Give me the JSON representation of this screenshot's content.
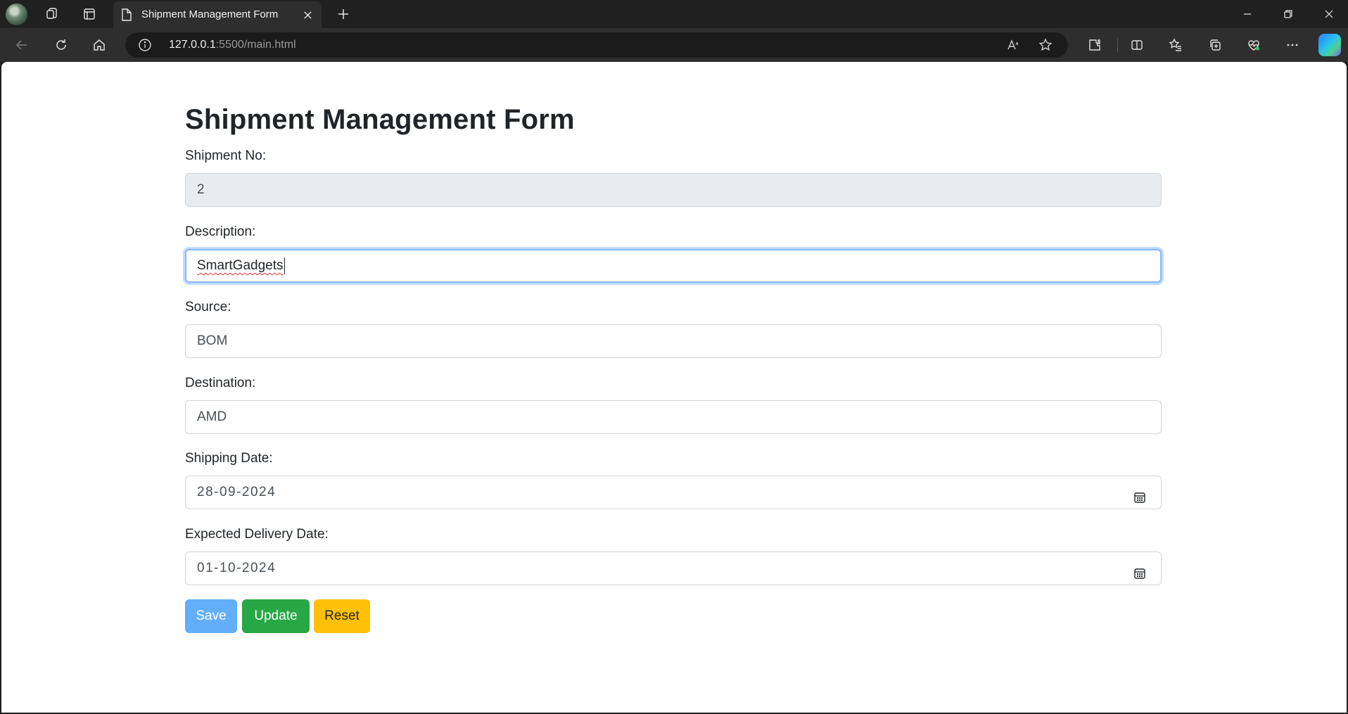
{
  "browser": {
    "tab_title": "Shipment Management Form",
    "url_host": "127.0.0.1",
    "url_rest": ":5500/main.html",
    "icons": [
      "profile-avatar",
      "workspaces-icon",
      "tab-actions-icon",
      "document-icon",
      "close-icon",
      "new-tab-icon",
      "minimize-icon",
      "restore-icon",
      "window-close-icon",
      "back-icon",
      "refresh-icon",
      "home-icon",
      "site-info-icon",
      "read-aloud-icon",
      "favorite-star-icon",
      "extensions-icon",
      "split-screen-icon",
      "favorites-icon",
      "collections-icon",
      "browser-essentials-icon",
      "more-icon",
      "copilot-icon"
    ]
  },
  "form": {
    "title": "Shipment Management Form",
    "fields": {
      "shipment_no": {
        "label": "Shipment No:",
        "value": "2"
      },
      "description": {
        "label": "Description:",
        "value": "SmartGadgets"
      },
      "source": {
        "label": "Source:",
        "value": "BOM"
      },
      "destination": {
        "label": "Destination:",
        "value": "AMD"
      },
      "shipping_date": {
        "label": "Shipping Date:",
        "value": "28-09-2024"
      },
      "delivery_date": {
        "label": "Expected Delivery Date:",
        "value": "01-10-2024"
      }
    },
    "buttons": {
      "save": "Save",
      "update": "Update",
      "reset": "Reset"
    }
  },
  "colors": {
    "save": "#62aefb",
    "update": "#28a745",
    "reset": "#ffc107",
    "focus_border": "#86b7fe",
    "readonly_bg": "#e9ecef"
  }
}
